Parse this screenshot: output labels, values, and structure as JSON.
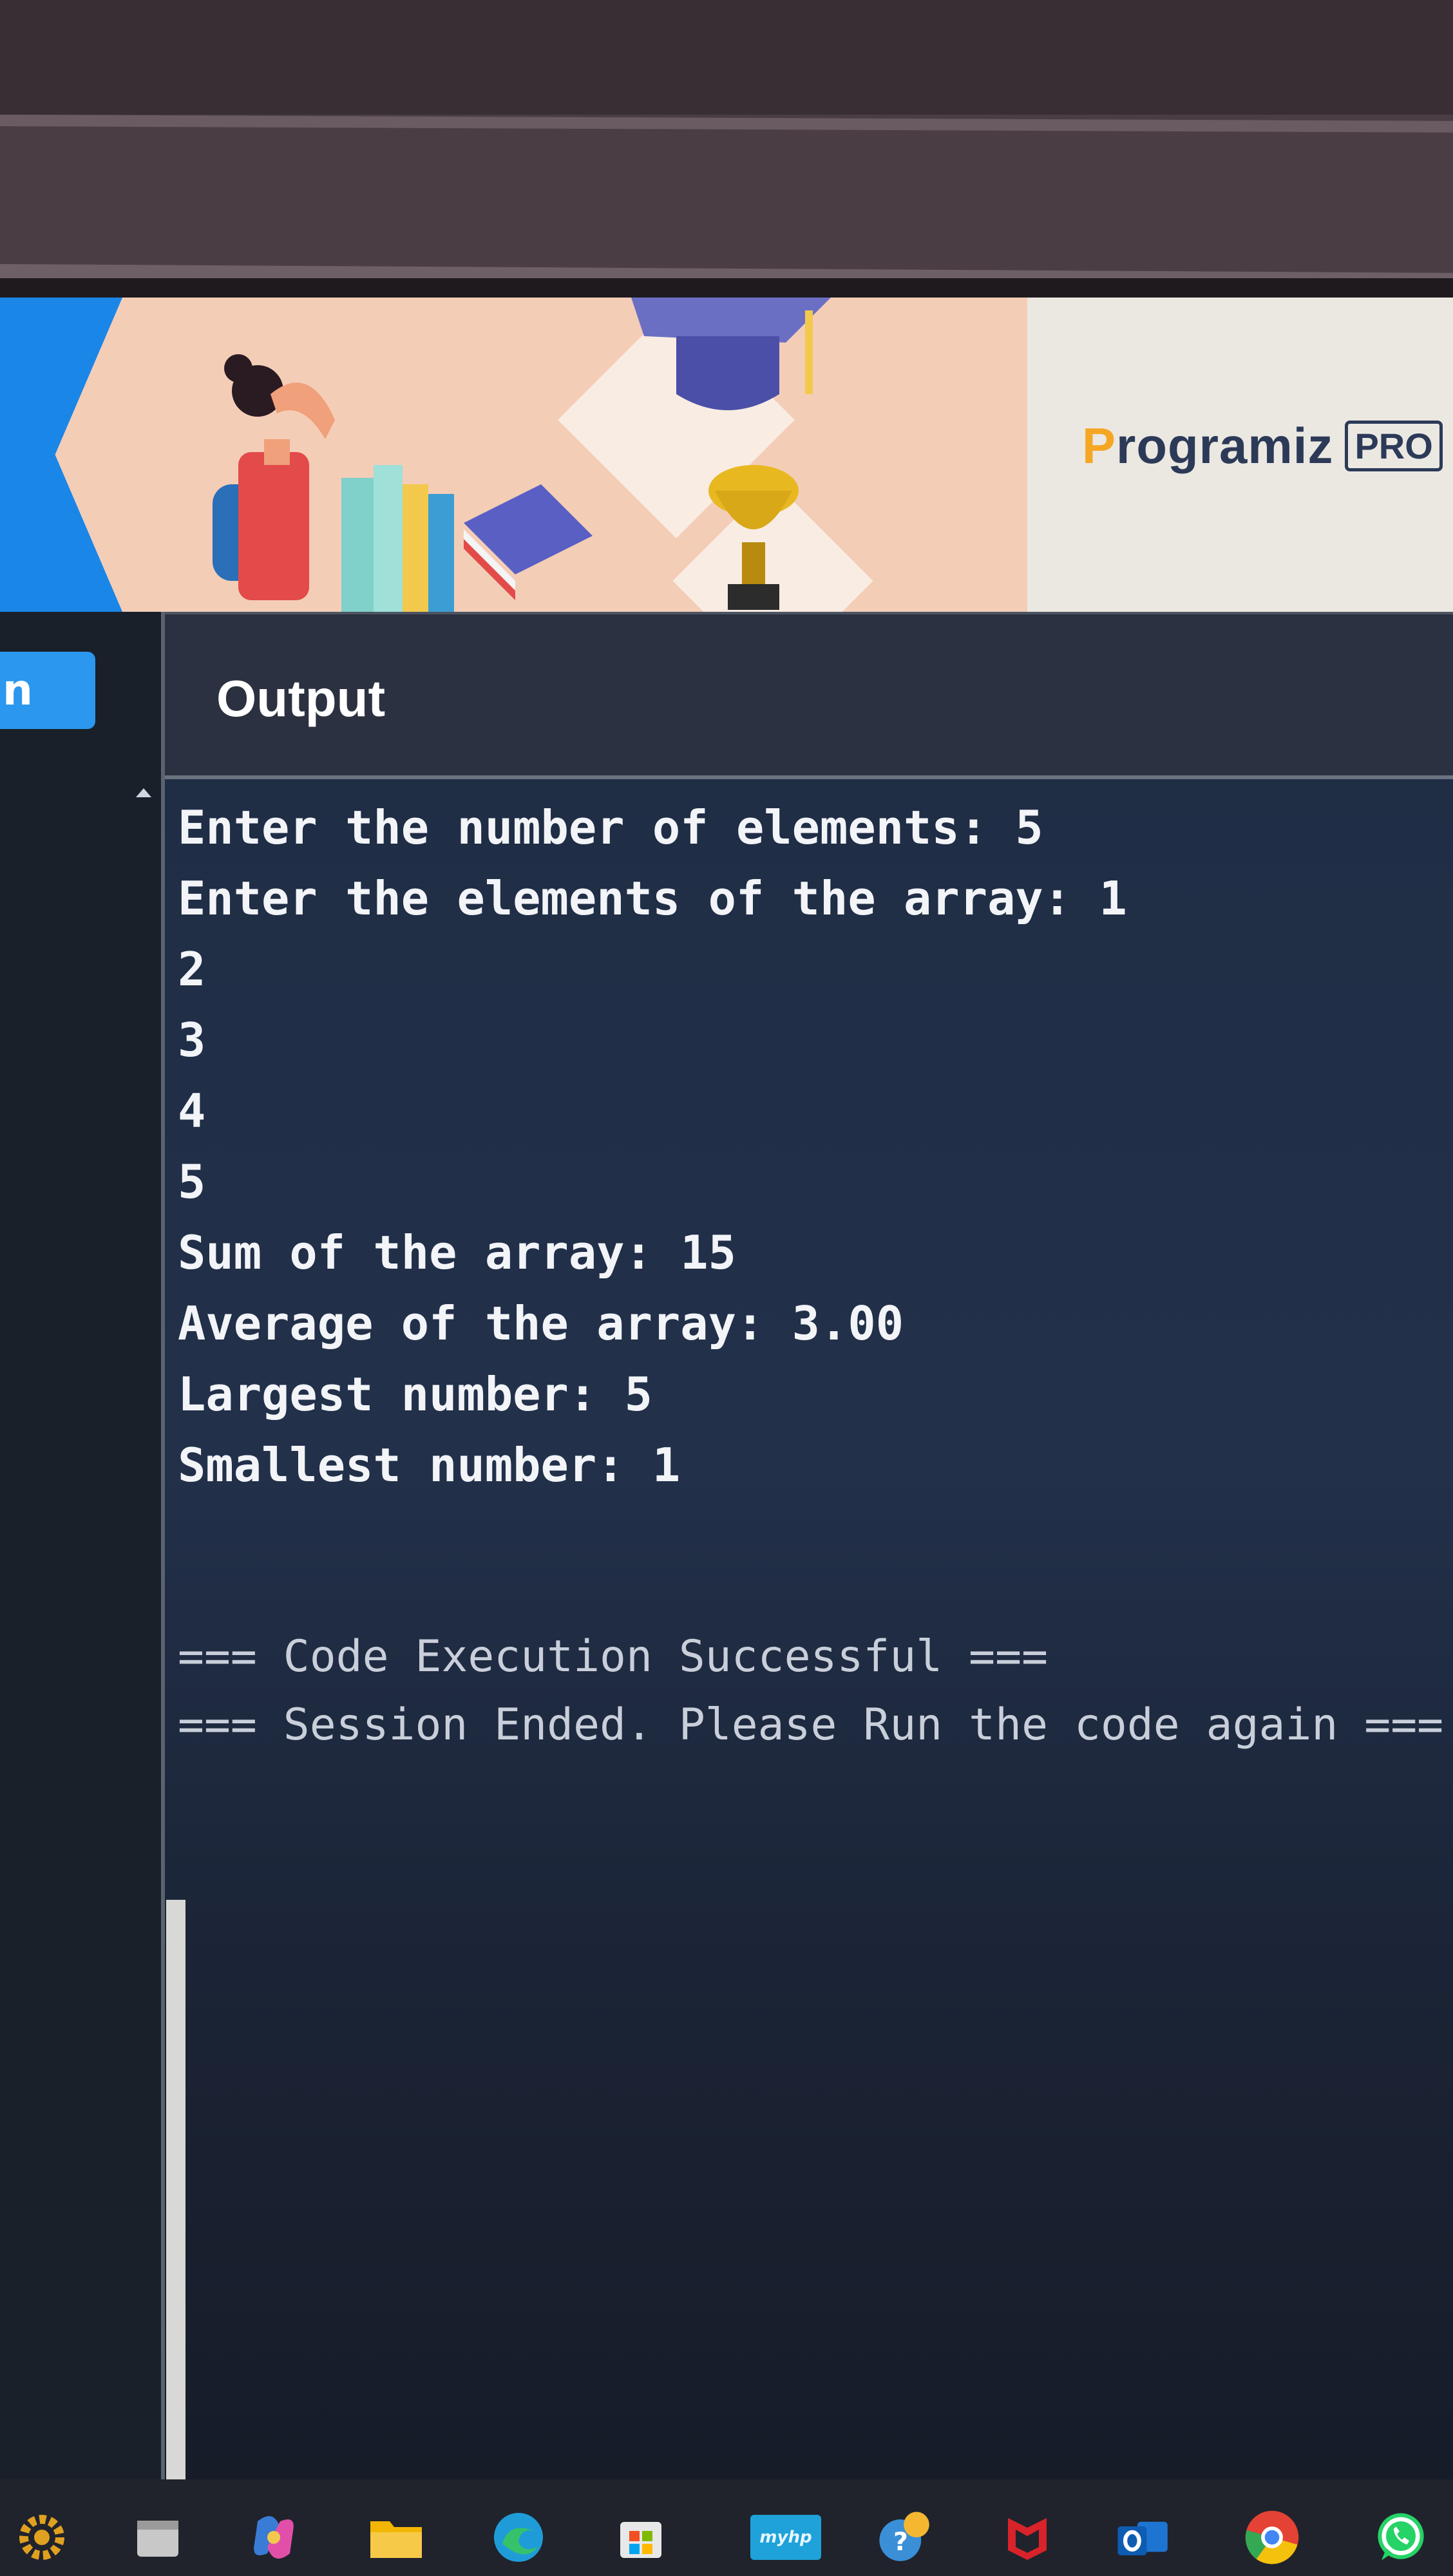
{
  "banner": {
    "logo_text": "rogramiz",
    "logo_initial": "P",
    "badge": "PRO"
  },
  "sidebar": {
    "run_label": "n"
  },
  "output": {
    "title": "Output",
    "lines": [
      "Enter the number of elements: 5",
      "Enter the elements of the array: 1",
      "2",
      "3",
      "4",
      "5",
      "Sum of the array: 15",
      "Average of the array: 3.00",
      "Largest number: 5",
      "Smallest number: 1"
    ],
    "success_message": "=== Code Execution Successful ===",
    "session_message": "=== Session Ended. Please Run the code again ==="
  },
  "taskbar": {
    "icons": [
      "settings-icon",
      "file-icon",
      "copilot-icon",
      "folder-icon",
      "edge-icon",
      "store-icon",
      "myhp-icon",
      "help-icon",
      "mcafee-icon",
      "outlook-icon",
      "chrome-icon",
      "whatsapp-icon"
    ],
    "myhp_label": "myhp"
  },
  "colors": {
    "brand_blue": "#2b97ee",
    "terminal_bg": "#1f2d45",
    "banner_bg": "#f4cdb7"
  }
}
